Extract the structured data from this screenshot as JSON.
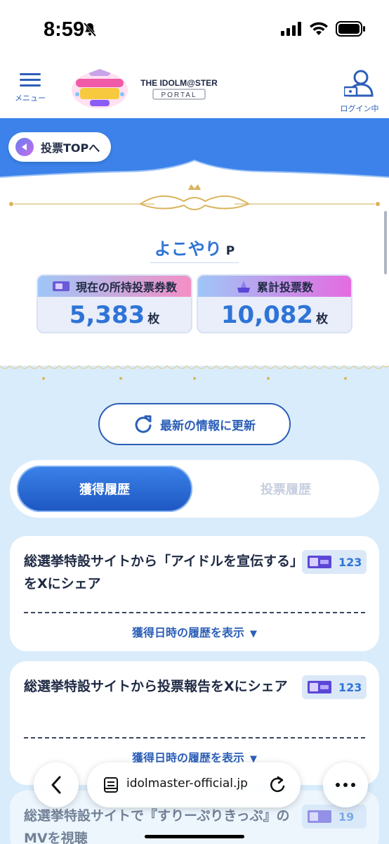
{
  "status_bar": {
    "time": "8:59",
    "icons": [
      "bell-slash-icon",
      "cellular-signal-icon",
      "wifi-icon",
      "battery-icon"
    ]
  },
  "header": {
    "menu_label": "メニュー",
    "login_label": "ログイン中",
    "logo_event_alt": "シンデレラガール総選挙 2024",
    "logo_portal_alt": "THE IDOLM@STER PORTAL"
  },
  "banner": {
    "back_label": "投票TOPへ"
  },
  "profile": {
    "name": "よこやり",
    "suffix": "P"
  },
  "stats": {
    "owned_label": "現在の所持投票券数",
    "owned_value": "5,383",
    "owned_unit": "枚",
    "total_label": "累計投票数",
    "total_value": "10,082",
    "total_unit": "枚"
  },
  "refresh_label": "最新の情報に更新",
  "tabs": {
    "acquired": "獲得履歴",
    "votes": "投票履歴"
  },
  "history": [
    {
      "title": "総選挙特設サイトから「アイドルを宣伝する」をXにシェア",
      "count": "123",
      "toggle": "獲得日時の履歴を表示"
    },
    {
      "title": "総選挙特設サイトから投票報告をXにシェア",
      "count": "123",
      "toggle": "獲得日時の履歴を表示"
    },
    {
      "title": "総選挙特設サイトで『すりーぷりきっぷ』のMVを視聴",
      "count": "19",
      "toggle": ""
    }
  ],
  "browser": {
    "url": "idolmaster-official.jp"
  },
  "colors": {
    "brand_blue": "#3c82ea",
    "accent_text": "#2e74d6",
    "background_light": "#d9ecfb"
  }
}
